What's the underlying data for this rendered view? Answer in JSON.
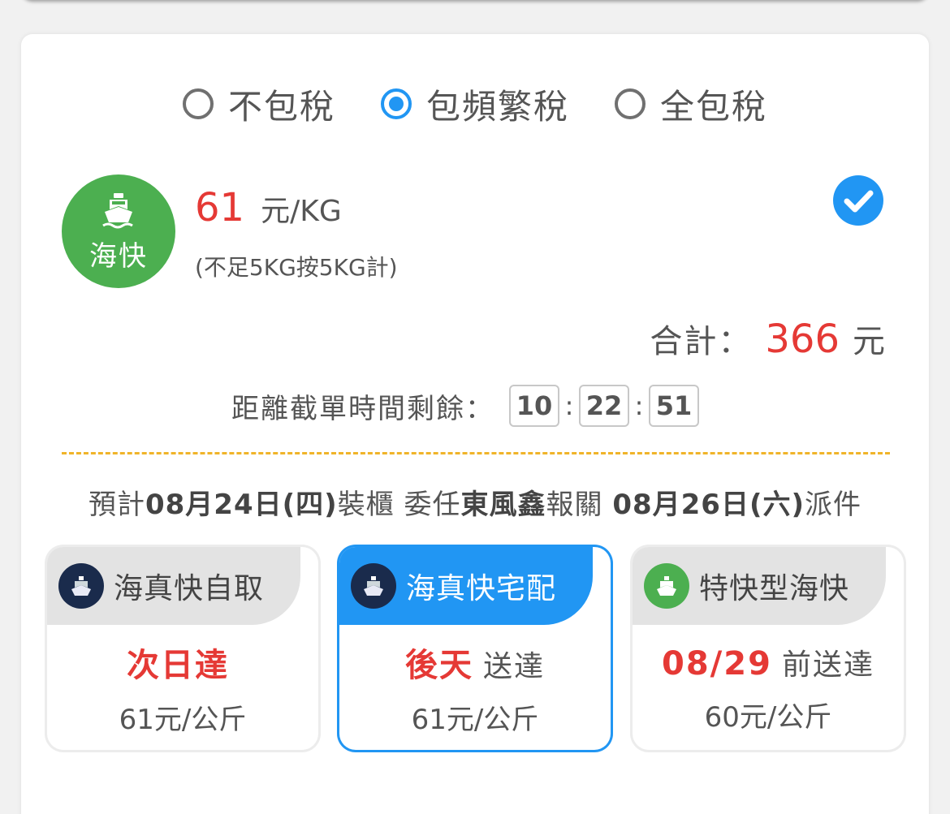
{
  "tax_options": [
    {
      "label": "不包稅",
      "selected": false
    },
    {
      "label": "包頻繁稅",
      "selected": true
    },
    {
      "label": "全包稅",
      "selected": false
    }
  ],
  "method": {
    "logo_text": "海快",
    "price": "61",
    "unit": "元/KG",
    "note": "(不足5KG按5KG計)",
    "logo_color": "#4caf50"
  },
  "total": {
    "label": "合計：",
    "amount": "366",
    "unit": "元"
  },
  "countdown": {
    "label": "距離截單時間剩餘：",
    "hours": "10",
    "minutes": "22",
    "seconds": "51"
  },
  "schedule": {
    "t1": "預計",
    "load_date": "08月24日(四)",
    "t2": "裝櫃 委任",
    "broker": "東風鑫",
    "t3": "報關 ",
    "dispatch_date": "08月26日(六)",
    "t4": "派件"
  },
  "delivery_options": [
    {
      "name": "海真快自取",
      "arrive_highlight": "次日達",
      "arrive_rest": "",
      "price": "61元/公斤",
      "icon": "ship-icon",
      "icon_bg": "#1a2b4c",
      "selected": false
    },
    {
      "name": "海真快宅配",
      "arrive_highlight": "後天",
      "arrive_rest": "送達",
      "price": "61元/公斤",
      "icon": "ship-icon",
      "icon_bg": "#1a2b4c",
      "selected": true
    },
    {
      "name": "特快型海快",
      "arrive_highlight": "08/29",
      "arrive_rest": "前送達",
      "price": "60元/公斤",
      "icon": "ship-icon",
      "icon_bg": "#4caf50",
      "selected": false
    }
  ],
  "colors": {
    "accent": "#2196f3",
    "price_red": "#e53935",
    "dash": "#f0b429"
  }
}
